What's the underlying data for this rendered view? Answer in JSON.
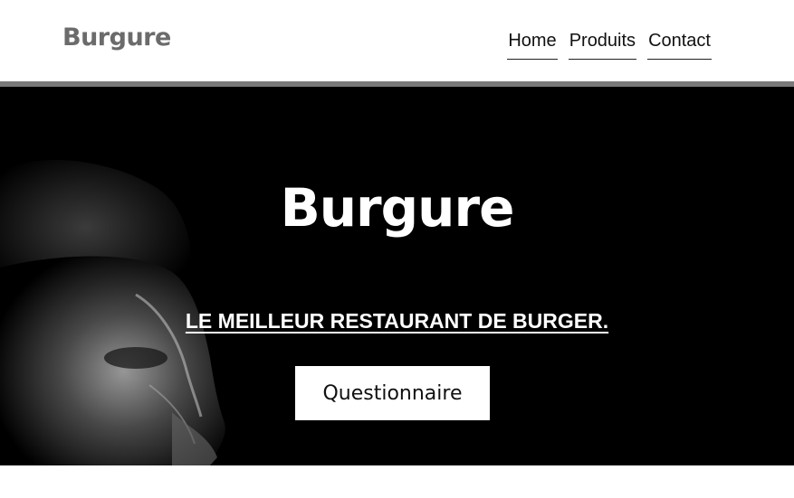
{
  "header": {
    "logo": "Burgure",
    "nav": [
      {
        "label": "Home"
      },
      {
        "label": "Produits"
      },
      {
        "label": "Contact"
      }
    ]
  },
  "hero": {
    "title": "Burgure",
    "tagline": "LE MEILLEUR RESTAURANT DE BURGER.",
    "cta_label": "Questionnaire"
  },
  "colors": {
    "logo": "#6b6b6b",
    "divider": "#7a7a7a",
    "hero_bg": "#000000",
    "hero_text": "#ffffff"
  }
}
